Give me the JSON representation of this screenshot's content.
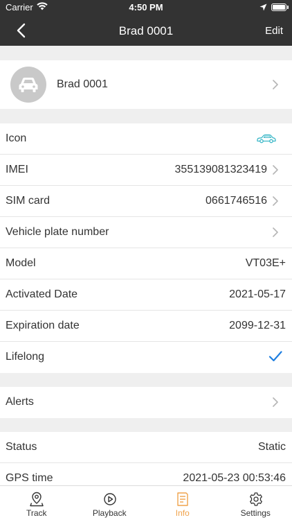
{
  "status_bar": {
    "carrier": "Carrier",
    "time": "4:50 PM"
  },
  "nav": {
    "title": "Brad 0001",
    "edit_label": "Edit"
  },
  "profile": {
    "name": "Brad 0001"
  },
  "device_rows": [
    {
      "label": "Icon",
      "value": ""
    },
    {
      "label": "IMEI",
      "value": "355139081323419"
    },
    {
      "label": "SIM card",
      "value": "0661746516"
    },
    {
      "label": "Vehicle plate number",
      "value": ""
    },
    {
      "label": "Model",
      "value": "VT03E+"
    },
    {
      "label": "Activated Date",
      "value": "2021-05-17"
    },
    {
      "label": "Expiration date",
      "value": "2099-12-31"
    },
    {
      "label": "Lifelong",
      "value": ""
    }
  ],
  "alerts_row": {
    "label": "Alerts"
  },
  "status_rows": [
    {
      "label": "Status",
      "value": "Static"
    },
    {
      "label": "GPS time",
      "value": "2021-05-23 00:53:46"
    }
  ],
  "tabs": [
    {
      "label": "Track",
      "icon": "location-pin-icon"
    },
    {
      "label": "Playback",
      "icon": "play-circle-icon"
    },
    {
      "label": "Info",
      "icon": "document-icon"
    },
    {
      "label": "Settings",
      "icon": "gear-icon"
    }
  ],
  "active_tab": "Info",
  "colors": {
    "header": "#333333",
    "accent_active_tab": "#f0a24a",
    "checkmark": "#1e7ee0",
    "vehicle_icon": "#3cb8c8"
  }
}
